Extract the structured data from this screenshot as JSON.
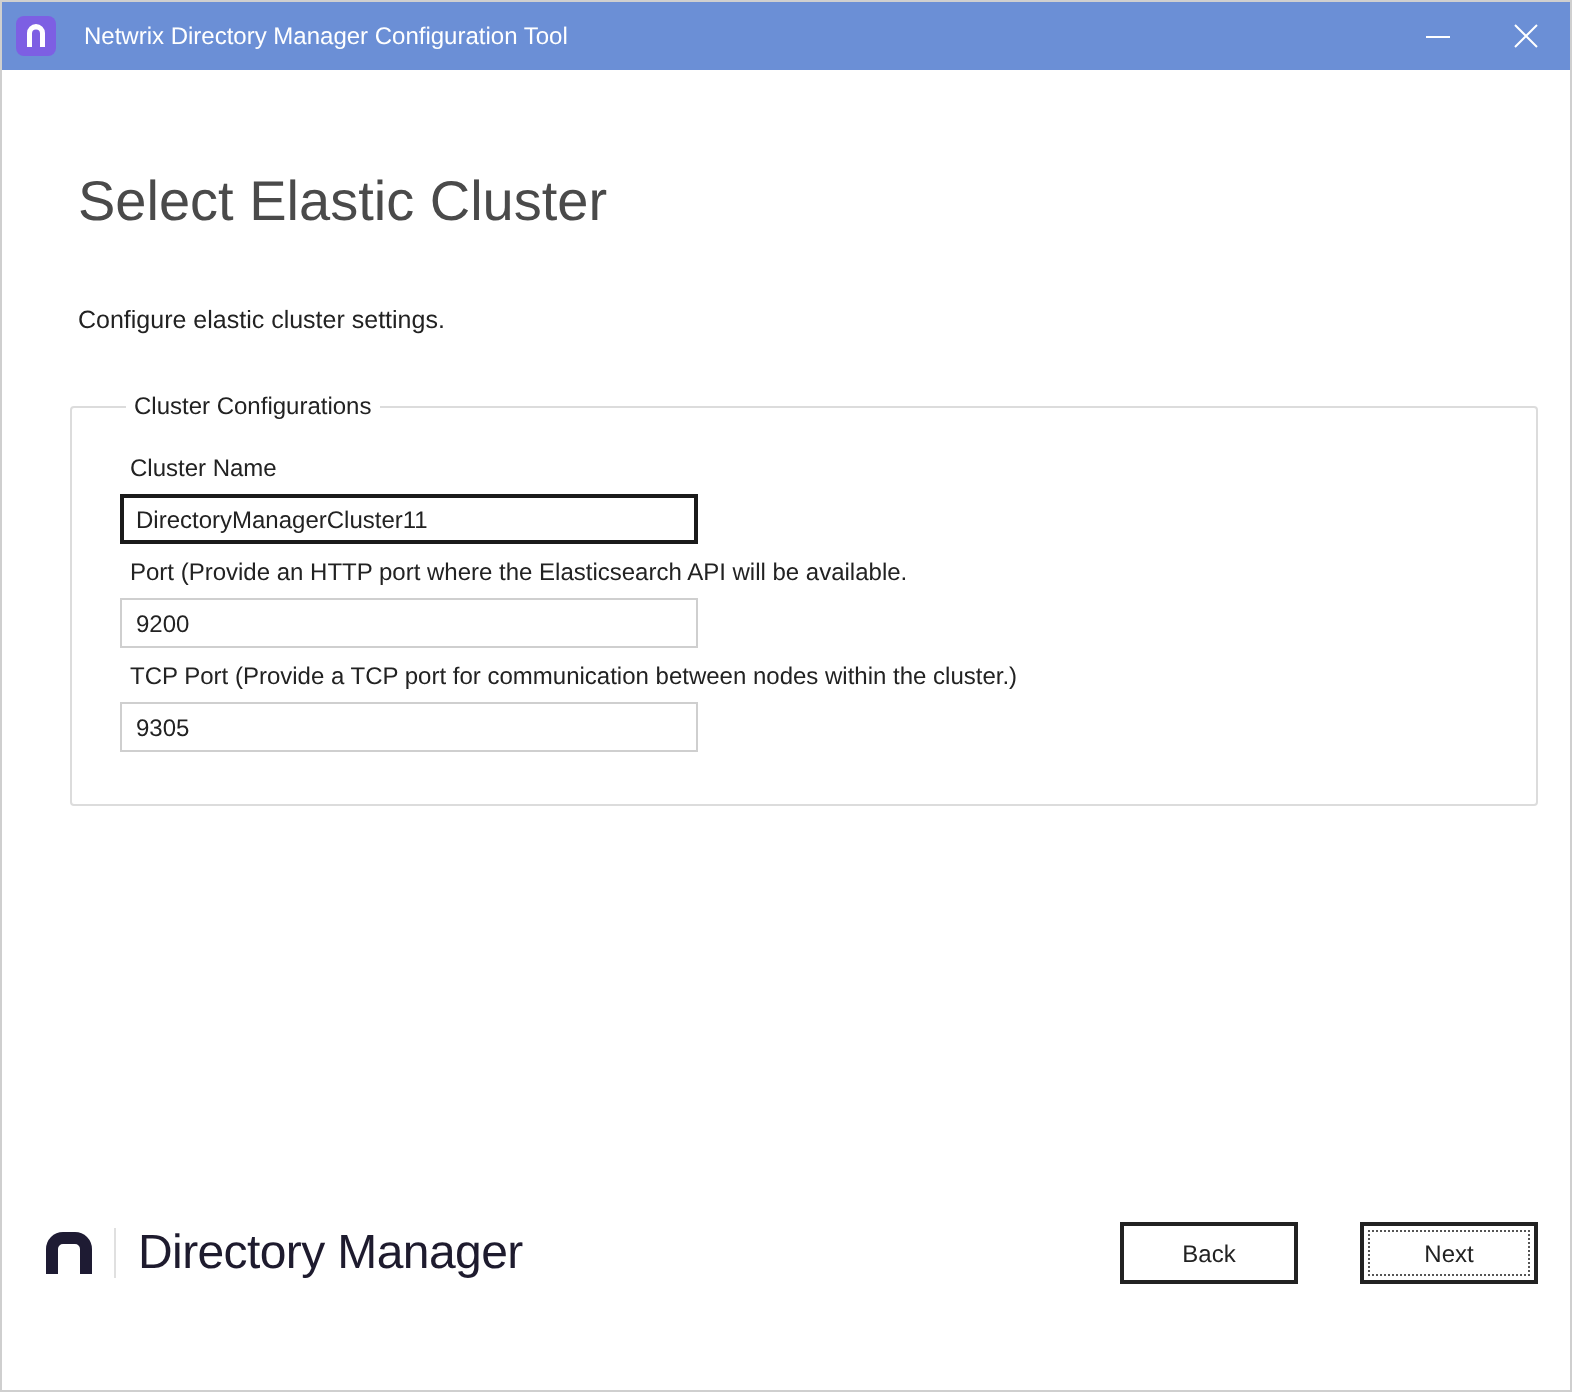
{
  "window": {
    "title": "Netwrix Directory Manager Configuration Tool"
  },
  "page": {
    "heading": "Select Elastic Cluster",
    "description": "Configure elastic cluster settings."
  },
  "group": {
    "legend": "Cluster Configurations",
    "fields": [
      {
        "label": "Cluster Name",
        "value": "DirectoryManagerCluster11",
        "focused": true
      },
      {
        "label": "Port (Provide an HTTP port where the Elasticsearch API will be available.",
        "value": "9200",
        "focused": false
      },
      {
        "label": "TCP Port (Provide a TCP port for communication between nodes within the cluster.)",
        "value": "9305",
        "focused": false
      }
    ]
  },
  "footer": {
    "brand": "Directory Manager",
    "buttons": [
      {
        "label": "Back",
        "focused": false
      },
      {
        "label": "Next",
        "focused": true
      }
    ]
  }
}
